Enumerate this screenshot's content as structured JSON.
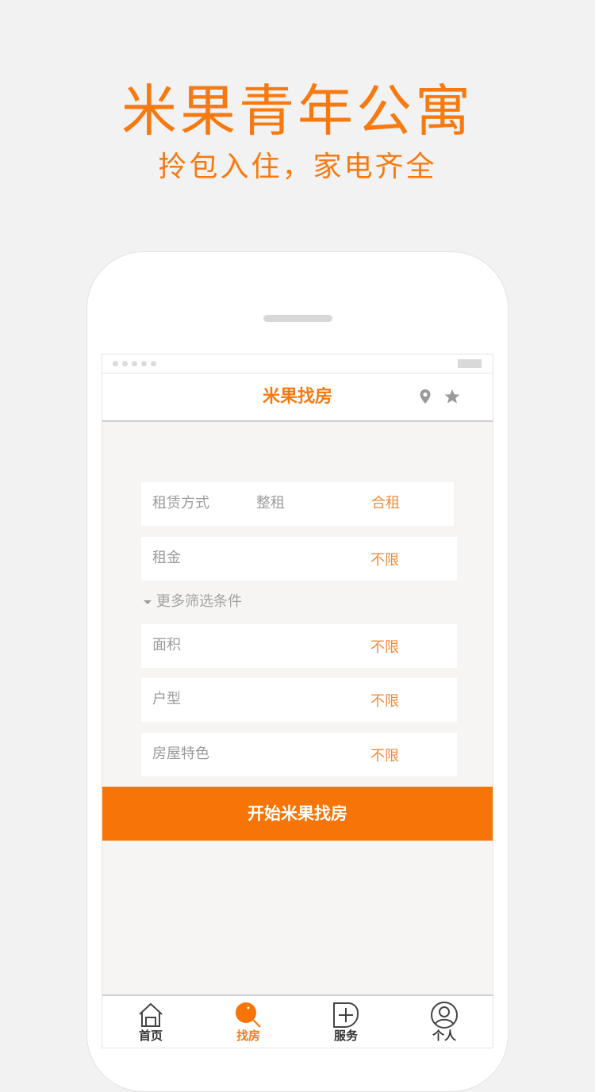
{
  "hero": {
    "title": "米果青年公寓",
    "subtitle": "拎包入住，家电齐全"
  },
  "colors": {
    "accent": "#f77a10",
    "button": "#f77506",
    "option_orange": "#f08a3c",
    "label_gray": "#9b9b9b"
  },
  "navbar": {
    "title": "米果找房",
    "icons": [
      "location-pin-icon",
      "star-icon"
    ]
  },
  "filters": {
    "rent_type": {
      "label": "租赁方式",
      "options": [
        {
          "label": "整租",
          "selected": false
        },
        {
          "label": "合租",
          "selected": true
        }
      ]
    },
    "rent": {
      "label": "租金",
      "value": "不限"
    },
    "more_toggle": "更多筛选条件",
    "area": {
      "label": "面积",
      "value": "不限"
    },
    "layout": {
      "label": "户型",
      "value": "不限"
    },
    "features": {
      "label": "房屋特色",
      "value": "不限"
    }
  },
  "cta": {
    "label": "开始米果找房"
  },
  "tabbar": {
    "items": [
      {
        "label": "首页",
        "icon": "home-icon",
        "active": false
      },
      {
        "label": "找房",
        "icon": "search-icon",
        "active": true
      },
      {
        "label": "服务",
        "icon": "service-plus-icon",
        "active": false
      },
      {
        "label": "个人",
        "icon": "user-icon",
        "active": false
      }
    ]
  }
}
